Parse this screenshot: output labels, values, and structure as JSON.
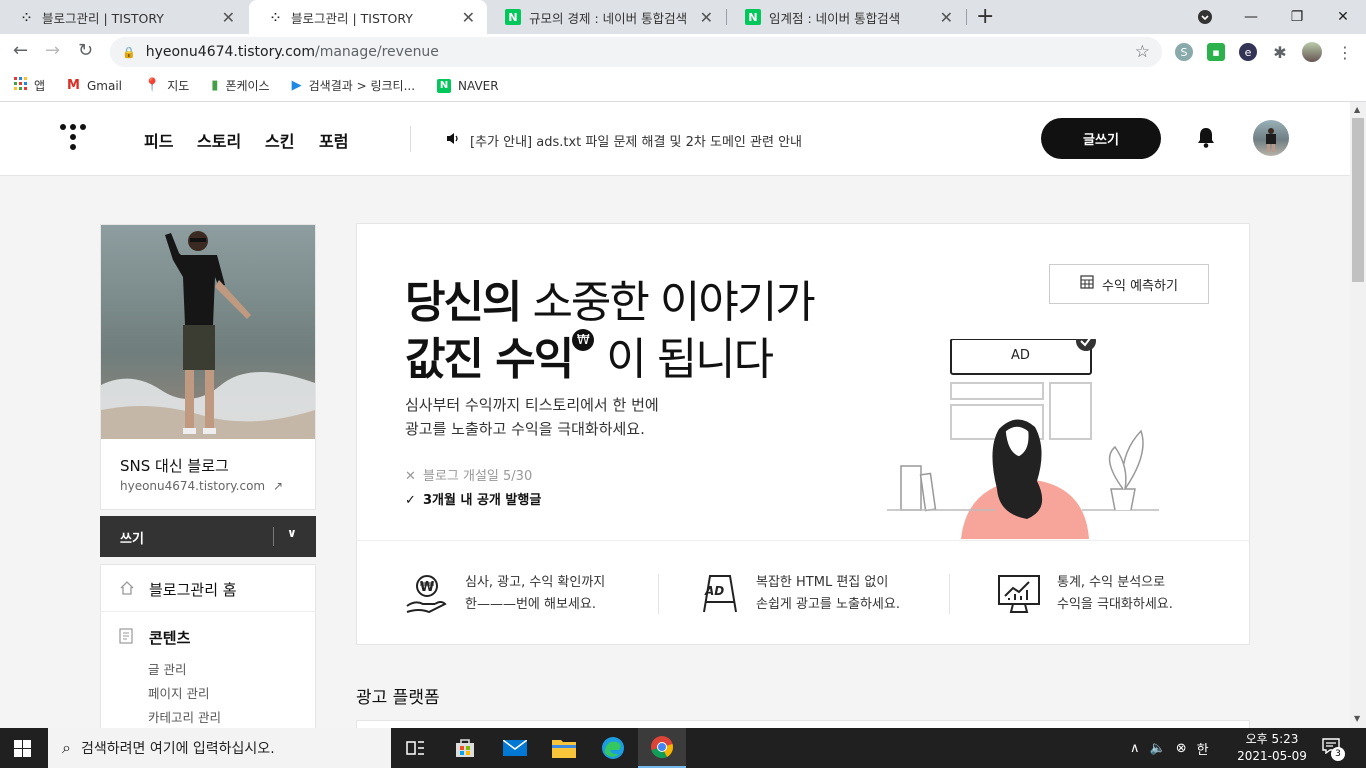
{
  "browser": {
    "tabs": [
      {
        "title": "블로그관리 | TISTORY",
        "active": false
      },
      {
        "title": "블로그관리 | TISTORY",
        "active": true
      },
      {
        "title": "규모의 경제 : 네이버 통합검색",
        "active": false,
        "favicon": "N"
      },
      {
        "title": "임계점 : 네이버 통합검색",
        "active": false,
        "favicon": "N"
      }
    ],
    "tab_close": "✕",
    "new_tab": "+",
    "url_host": "hyeonu4674.tistory.com",
    "url_path": "/manage/revenue",
    "bookmarks": [
      {
        "label": "앱",
        "icon": "apps-grid-icon"
      },
      {
        "label": "Gmail",
        "icon": "gmail-icon"
      },
      {
        "label": "지도",
        "icon": "maps-pin-icon"
      },
      {
        "label": "폰케이스",
        "icon": "bookmark-icon"
      },
      {
        "label": "검색결과 > 링크티...",
        "icon": "play-icon"
      },
      {
        "label": "NAVER",
        "icon": "naver-icon"
      }
    ],
    "naver_favicon": "N"
  },
  "header": {
    "nav": [
      "피드",
      "스토리",
      "스킨",
      "포럼"
    ],
    "notice": "[추가 안내] ads.txt 파일 문제 해결 및 2차 도메인 관련 안내",
    "write_label": "글쓰기"
  },
  "sidebar": {
    "blog_title": "SNS 대신 블로그",
    "blog_url": "hyeonu4674.tistory.com",
    "write_label": "쓰기",
    "menu_home": "블로그관리 홈",
    "menu_contents": "콘텐츠",
    "sub_items": [
      "글 관리",
      "페이지 관리",
      "카테고리 관리"
    ]
  },
  "hero": {
    "line1_bold": "당신의",
    "line1_rest": " 소중한 이야기가",
    "line2_bold": "값진 수익",
    "won_symbol": "₩",
    "line2_rest": " 이 됩니다",
    "desc1": "심사부터 수익까지 티스토리에서 한 번에",
    "desc2": "광고를 노출하고 수익을 극대화하세요.",
    "req1_mark": "✕",
    "req1": "블로그 개설일 5/30",
    "req2_mark": "✓",
    "req2": "3개월 내 공개 발행글",
    "forecast_label": "수익 예측하기",
    "illust_ad_label": "AD"
  },
  "features": [
    {
      "line1": "심사, 광고, 수익 확인까지",
      "line2": "한———번에 해보세요."
    },
    {
      "icon_label": "AD",
      "line1": "복잡한 HTML 편집 없이",
      "line2": "손쉽게 광고를 노출하세요."
    },
    {
      "line1": "통계, 수익 분석으로",
      "line2": "수익을 극대화하세요."
    }
  ],
  "section_title": "광고 플랫폼",
  "taskbar": {
    "search_placeholder": "검색하려면 여기에 입력하십시오.",
    "ime": "한",
    "time": "오후 5:23",
    "date": "2021-05-09",
    "notifications": "3"
  }
}
